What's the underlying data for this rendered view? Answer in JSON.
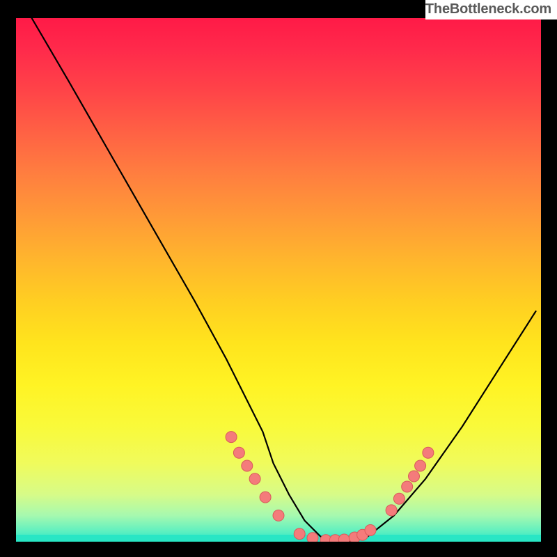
{
  "attribution": "TheBottleneck.com",
  "colors": {
    "frame_bg": "#000000",
    "curve": "#000000",
    "dot_fill": "#f47b7b",
    "dot_stroke": "#d85a5a",
    "grad_top": "#ff1a47",
    "grad_bottom": "#29e6c5"
  },
  "chart_data": {
    "type": "line",
    "title": "",
    "xlabel": "",
    "ylabel": "",
    "xlim": [
      0,
      100
    ],
    "ylim": [
      0,
      100
    ],
    "grid": false,
    "series": [
      {
        "name": "bottleneck-curve",
        "x": [
          3,
          10,
          18,
          26,
          34,
          40,
          44,
          47,
          49,
          52,
          55,
          58,
          61,
          64,
          67,
          72,
          78,
          85,
          92,
          99
        ],
        "values": [
          100,
          88,
          74,
          60,
          46,
          35,
          27,
          21,
          15,
          9,
          4,
          1,
          0,
          0,
          1,
          5,
          12,
          22,
          33,
          44
        ]
      }
    ],
    "dots_left": [
      {
        "x": 41.0,
        "y": 20.0
      },
      {
        "x": 42.5,
        "y": 17.0
      },
      {
        "x": 44.0,
        "y": 14.5
      },
      {
        "x": 45.5,
        "y": 12.0
      },
      {
        "x": 47.5,
        "y": 8.5
      },
      {
        "x": 50.0,
        "y": 5.0
      }
    ],
    "dots_bottom": [
      {
        "x": 54.0,
        "y": 1.5
      },
      {
        "x": 56.5,
        "y": 0.7
      },
      {
        "x": 59.0,
        "y": 0.3
      },
      {
        "x": 60.8,
        "y": 0.3
      },
      {
        "x": 62.5,
        "y": 0.4
      },
      {
        "x": 64.5,
        "y": 0.8
      },
      {
        "x": 66.0,
        "y": 1.3
      },
      {
        "x": 67.5,
        "y": 2.2
      }
    ],
    "dots_right": [
      {
        "x": 71.5,
        "y": 6.0
      },
      {
        "x": 73.0,
        "y": 8.2
      },
      {
        "x": 74.5,
        "y": 10.5
      },
      {
        "x": 75.8,
        "y": 12.5
      },
      {
        "x": 77.0,
        "y": 14.5
      },
      {
        "x": 78.5,
        "y": 17.0
      }
    ]
  }
}
